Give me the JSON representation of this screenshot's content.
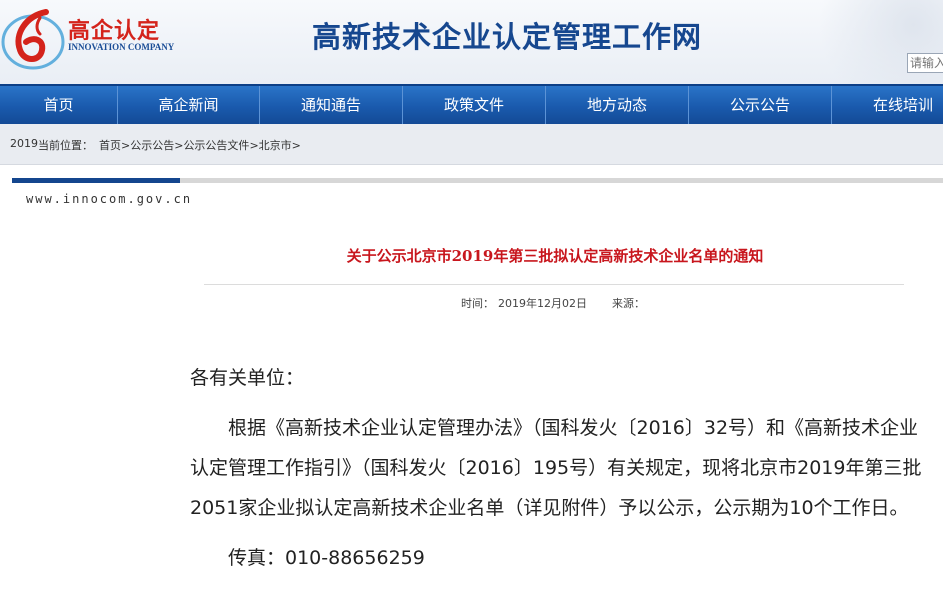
{
  "logo": {
    "cn": "高企认定",
    "en": "INNOVATION COMPANY",
    "icon": "stylized-red-six-swoosh-logo",
    "brand_red": "#d4231b",
    "brand_blue": "#1a4d96"
  },
  "header": {
    "site_title": "高新技术企业认定管理工作网",
    "search_placeholder": "请输入"
  },
  "nav": {
    "items": [
      {
        "label": "首页"
      },
      {
        "label": "高企新闻"
      },
      {
        "label": "通知通告"
      },
      {
        "label": "政策文件"
      },
      {
        "label": "地方动态"
      },
      {
        "label": "公示公告"
      },
      {
        "label": "在线培训"
      }
    ],
    "bg_color": "#1a5aad"
  },
  "breadcrumb": {
    "year": "2019",
    "label": "当前位置：",
    "items": [
      "首页",
      "公示公告",
      "公示公告文件",
      "北京市"
    ],
    "sep": ">"
  },
  "article": {
    "domain": "www.innocom.gov.cn",
    "title": "关于公示北京市2019年第三批拟认定高新技术企业名单的通知",
    "title_color": "#c8161d",
    "time_label": "时间：",
    "time_value": "2019年12月02日",
    "source_label": "来源：",
    "greeting": "各有关单位：",
    "paragraph": "根据《高新技术企业认定管理办法》（国科发火〔2016〕32号）和《高新技术企业认定管理工作指引》（国科发火〔2016〕195号）有关规定，现将北京市2019年第三批2051家企业拟认定高新技术企业名单（详见附件）予以公示，公示期为10个工作日。",
    "fax": "传真：010-88656259"
  }
}
